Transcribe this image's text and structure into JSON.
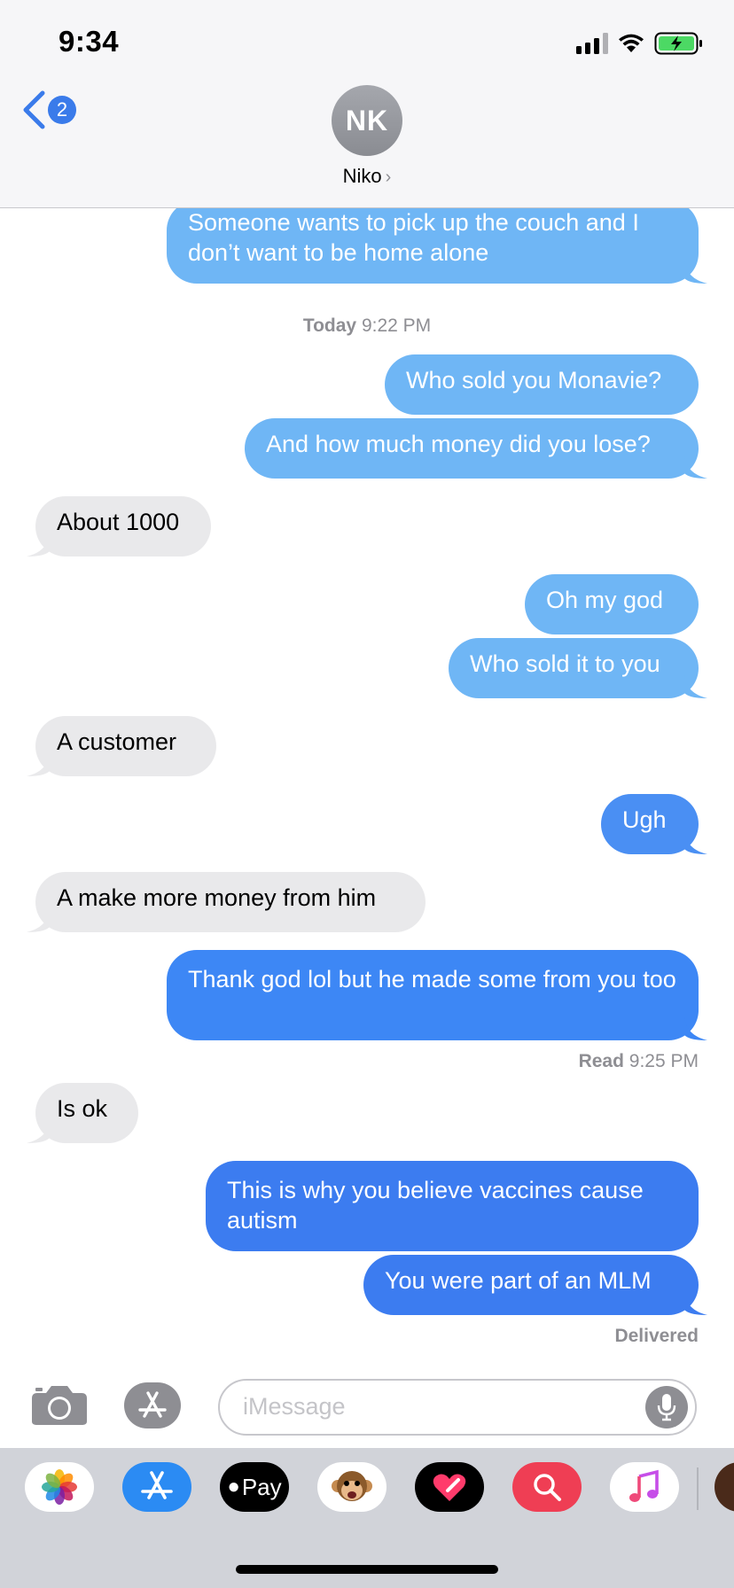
{
  "status_bar": {
    "time": "9:34"
  },
  "header": {
    "back_badge": "2",
    "avatar_initials": "NK",
    "contact_name": "Niko"
  },
  "conversation": {
    "timestamp_day": "Today",
    "timestamp_time": "9:22 PM",
    "read_label": "Read",
    "read_time": "9:25 PM",
    "delivered_label": "Delivered",
    "messages": [
      {
        "from": "me",
        "text": "Someone wants to pick up the couch and I don’t want to be home alone"
      },
      {
        "from": "me",
        "text": "Who sold you Monavie?"
      },
      {
        "from": "me",
        "text": "And how much money did you lose?"
      },
      {
        "from": "them",
        "text": "About 1000"
      },
      {
        "from": "me",
        "text": "Oh my god"
      },
      {
        "from": "me",
        "text": "Who sold it to you"
      },
      {
        "from": "them",
        "text": "A customer"
      },
      {
        "from": "me",
        "text": "Ugh"
      },
      {
        "from": "them",
        "text": "A make more money from him"
      },
      {
        "from": "me",
        "text": "Thank god lol but he made some from you too"
      },
      {
        "from": "them",
        "text": "Is ok"
      },
      {
        "from": "me",
        "text": "This is why you believe vaccines cause autism"
      },
      {
        "from": "me",
        "text": "You were part of an MLM"
      }
    ]
  },
  "input_bar": {
    "placeholder": "iMessage"
  },
  "app_drawer": {
    "apps": [
      {
        "name": "photos-icon"
      },
      {
        "name": "app-store-icon"
      },
      {
        "name": "apple-pay-icon",
        "label": "Pay"
      },
      {
        "name": "animoji-icon"
      },
      {
        "name": "digital-touch-icon"
      },
      {
        "name": "images-search-icon"
      },
      {
        "name": "music-icon"
      }
    ]
  },
  "colors": {
    "outgoing": "#3d87f5",
    "outgoing_light": "#6fb6f5",
    "incoming": "#e9e9eb",
    "accent": "#3a7bea"
  }
}
